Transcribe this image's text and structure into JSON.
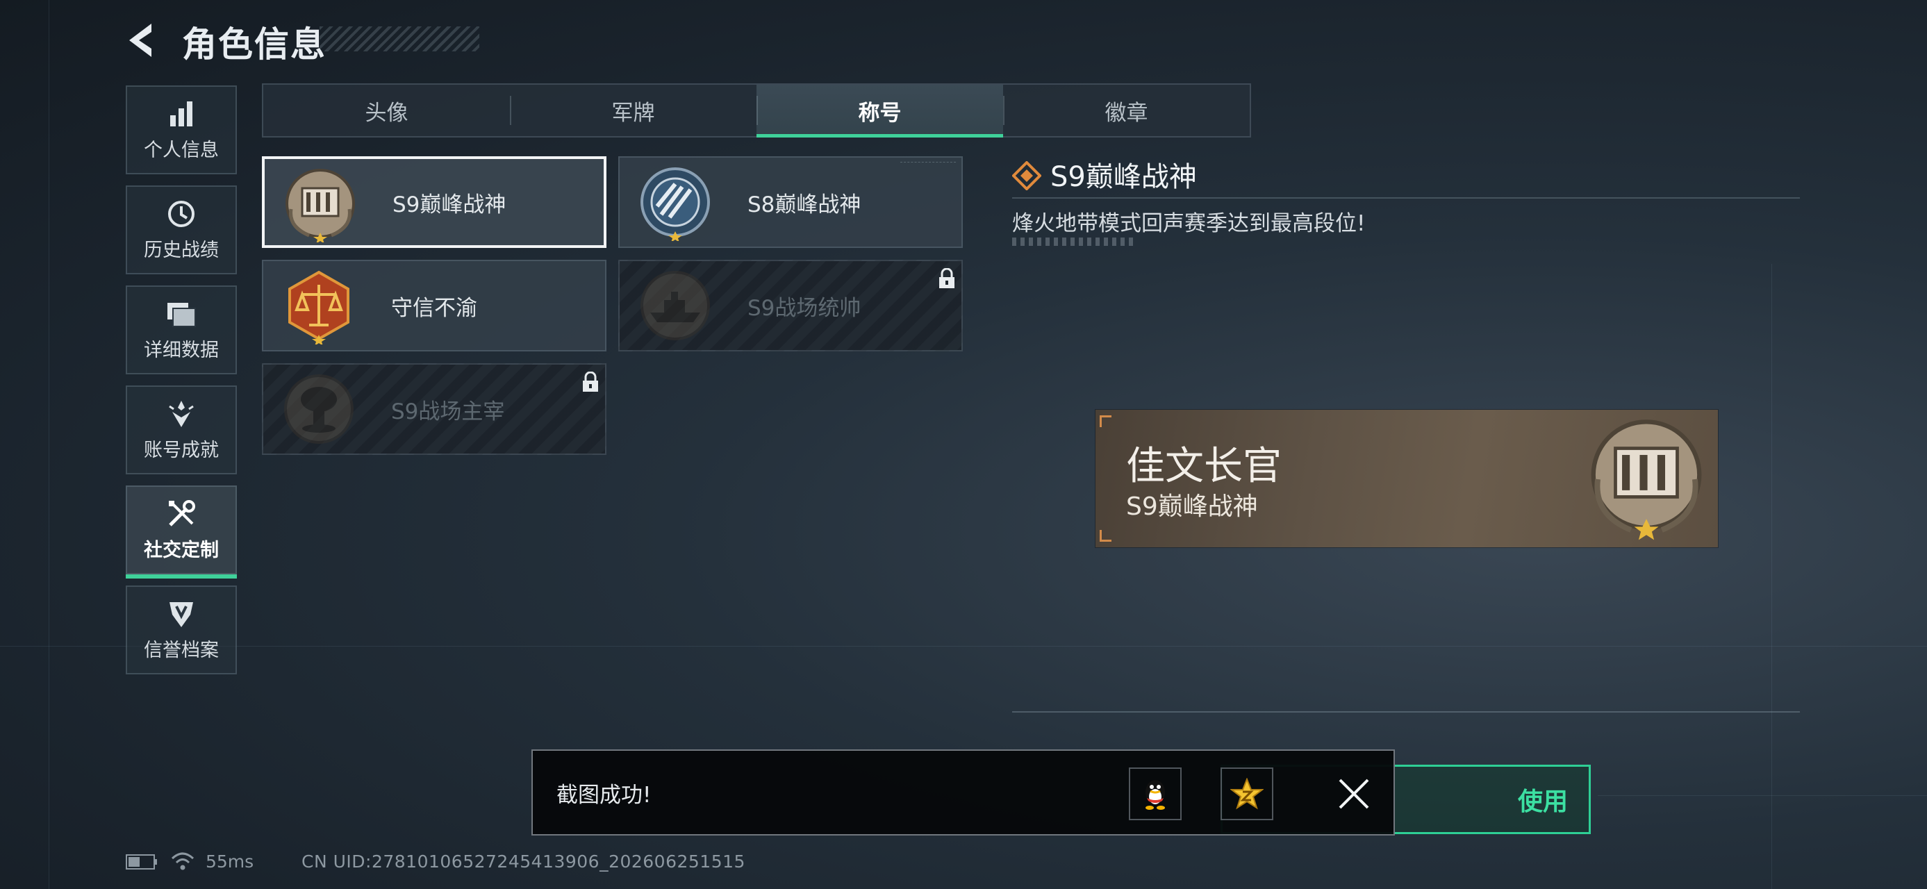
{
  "header": {
    "title": "角色信息"
  },
  "sidebar": {
    "items": [
      {
        "label": "个人信息",
        "icon": "bar-chart-icon",
        "active": false
      },
      {
        "label": "历史战绩",
        "icon": "clock-icon",
        "active": false
      },
      {
        "label": "详细数据",
        "icon": "folder-icon",
        "active": false
      },
      {
        "label": "账号成就",
        "icon": "achievement-icon",
        "active": false
      },
      {
        "label": "社交定制",
        "icon": "tools-icon",
        "active": true
      },
      {
        "label": "信誉档案",
        "icon": "shield-icon",
        "active": false
      }
    ]
  },
  "tabs": [
    {
      "label": "头像",
      "active": false
    },
    {
      "label": "军牌",
      "active": false
    },
    {
      "label": "称号",
      "active": true
    },
    {
      "label": "徽章",
      "active": false
    }
  ],
  "titles": [
    {
      "name": "S9巅峰战神",
      "badge": "fortress-badge-icon",
      "selected": true,
      "locked": false
    },
    {
      "name": "S8巅峰战神",
      "badge": "blue-emblem-badge-icon",
      "selected": false,
      "locked": false
    },
    {
      "name": "守信不渝",
      "badge": "scales-badge-icon",
      "selected": false,
      "locked": false
    },
    {
      "name": "S9战场统帅",
      "badge": "warship-badge-icon",
      "selected": false,
      "locked": true
    },
    {
      "name": "S9战场主宰",
      "badge": "mushroom-cloud-badge-icon",
      "selected": false,
      "locked": true
    }
  ],
  "detail": {
    "title": "S9巅峰战神",
    "description": "烽火地带模式回声赛季达到最高段位!"
  },
  "preview": {
    "player_name": "佳文长官",
    "title": "S9巅峰战神"
  },
  "use_button": {
    "label": "使用"
  },
  "toast": {
    "message": "截图成功!",
    "share_qq_icon": "qq-penguin-icon",
    "share_qzone_icon": "qzone-star-icon"
  },
  "footer": {
    "ping": "55ms",
    "uid": "CN UID:2781010652724541390​6_202606251515"
  },
  "colors": {
    "accent": "#3fd19a",
    "plate": "#5e5245",
    "bracket": "#d38b4a"
  }
}
